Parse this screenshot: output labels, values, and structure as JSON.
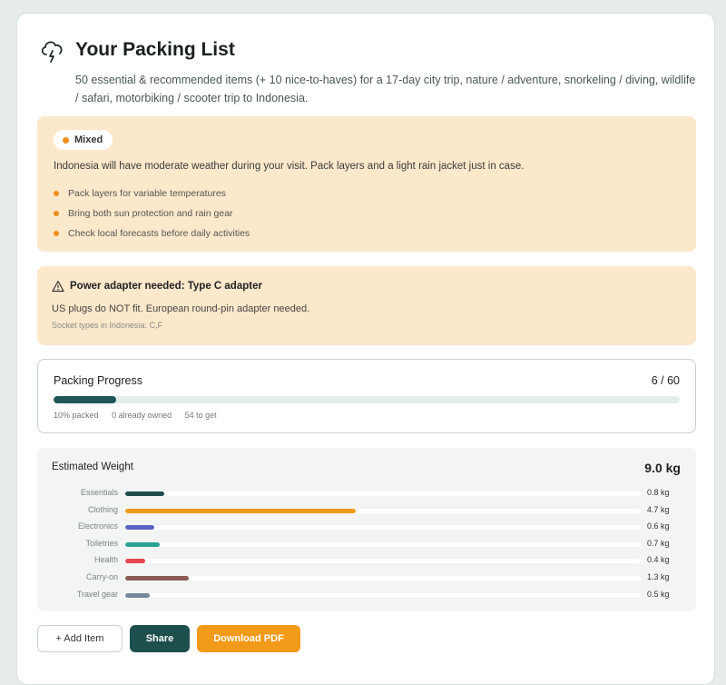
{
  "header": {
    "title": "Your Packing List",
    "subtitle": "50 essential & recommended items (+ 10 nice-to-haves) for a 17-day city trip, nature / adventure, snorkeling / diving, wildlife / safari, motorbiking / scooter trip to Indonesia."
  },
  "weather": {
    "badge": "Mixed",
    "message": "Indonesia will have moderate weather during your visit. Pack layers and a light rain jacket just in case.",
    "tips": [
      "Pack layers for variable temperatures",
      "Bring both sun protection and rain gear",
      "Check local forecasts before daily activities"
    ]
  },
  "adapter": {
    "title": "Power adapter needed: Type C adapter",
    "message": "US plugs do NOT fit. European round-pin adapter needed.",
    "socket_types": "Socket types in Indonesia: C,F"
  },
  "progress": {
    "title": "Packing Progress",
    "count": "6 / 60",
    "fraction": 0.1,
    "packed": "10% packed",
    "owned": "0 already owned",
    "to_get": "54 to get"
  },
  "weight": {
    "title": "Estimated Weight",
    "total": "9.0 kg",
    "max_kg": 10.5,
    "rows": [
      {
        "label": "Essentials",
        "value": "0.8 kg",
        "kg": 0.8,
        "color": "#1f4e4d"
      },
      {
        "label": "Clothing",
        "value": "4.7 kg",
        "kg": 4.7,
        "color": "#ef9b1a"
      },
      {
        "label": "Electronics",
        "value": "0.6 kg",
        "kg": 0.6,
        "color": "#5b63c4"
      },
      {
        "label": "Toiletries",
        "value": "0.7 kg",
        "kg": 0.7,
        "color": "#2aa394"
      },
      {
        "label": "Health",
        "value": "0.4 kg",
        "kg": 0.4,
        "color": "#e5484d"
      },
      {
        "label": "Carry-on",
        "value": "1.3 kg",
        "kg": 1.3,
        "color": "#8c5a52"
      },
      {
        "label": "Travel gear",
        "value": "0.5 kg",
        "kg": 0.5,
        "color": "#748899"
      }
    ]
  },
  "actions": {
    "add": "+ Add Item",
    "share": "Share",
    "pdf": "Download PDF"
  }
}
